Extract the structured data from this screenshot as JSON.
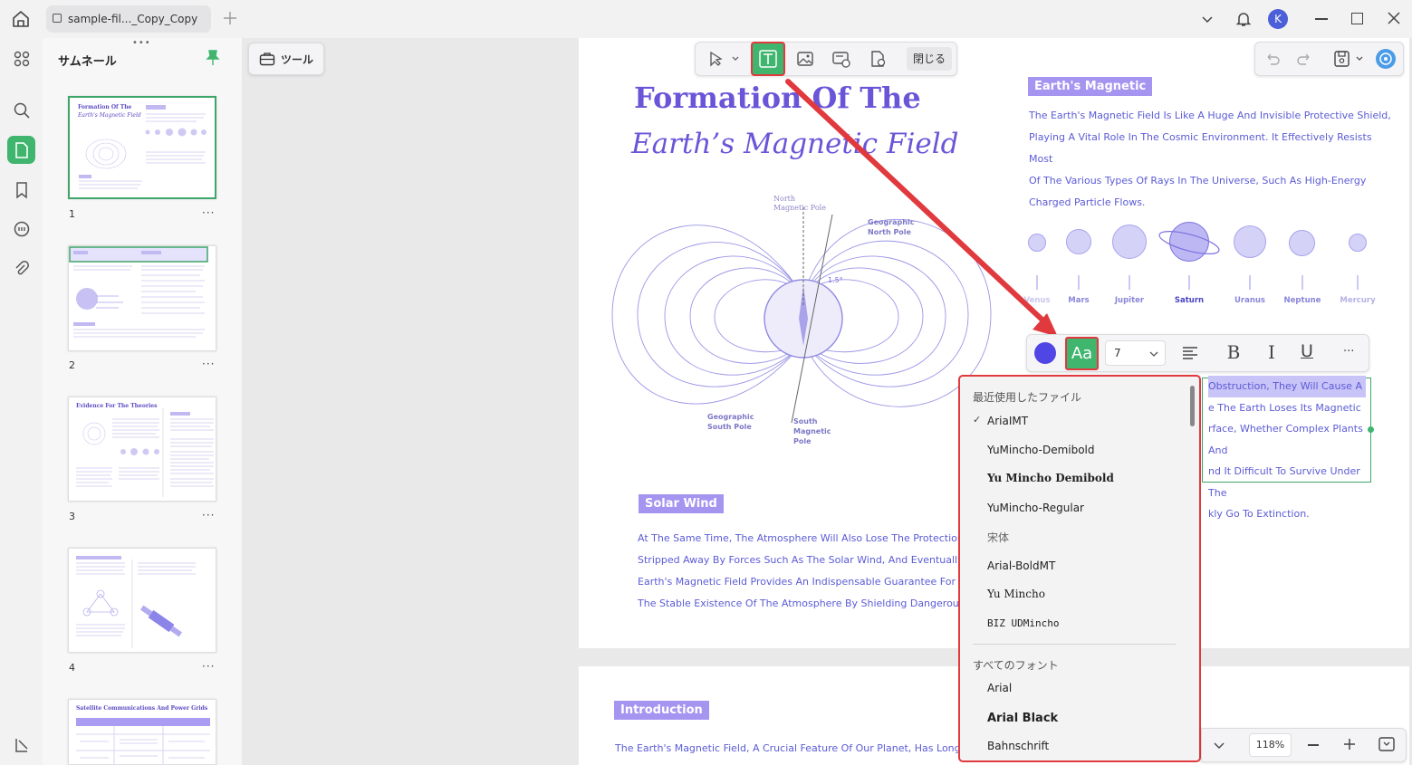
{
  "tabs": [
    {
      "label": "sample-fil..._Copy_Copy"
    }
  ],
  "window": {
    "avatar_letter": "K"
  },
  "sidebar": {
    "title": "サムネール",
    "pages": [
      {
        "num": "1"
      },
      {
        "num": "2"
      },
      {
        "num": "3"
      },
      {
        "num": "4"
      }
    ],
    "thumb_texts": {
      "p1_title": "Formation Of The",
      "p1_sub": "Earth's Magnetic Field",
      "p3_title": "Evidence For The Theories",
      "p5_title": "Satellite Communications And Power Grids"
    }
  },
  "tools_button": {
    "label": "ツール"
  },
  "edit_toolbar": {
    "close_label": "閉じる"
  },
  "document": {
    "title_line1": "Formation Of The",
    "title_line2": "Earth’s Magnetic Field",
    "diagram_labels": {
      "north_magnetic_pole": [
        "North",
        "Magnetic Pole"
      ],
      "geographic_north_pole": [
        "Geographic",
        "North Pole"
      ],
      "geographic_south_pole": [
        "Geographic",
        "South Pole"
      ],
      "south_magnetic_pole": [
        "South",
        "Magnetic",
        "Pole"
      ],
      "angle": "1.5°"
    },
    "earths_magnetic": {
      "tag": "Earth's Magnetic",
      "lines": [
        "The Earth's Magnetic Field Is Like A Huge And Invisible Protective Shield,",
        "Playing A Vital Role In The Cosmic Environment. It Effectively Resists Most",
        "Of The Various Types Of Rays In The Universe, Such As High-Energy",
        "Charged Particle Flows."
      ]
    },
    "planets": [
      "Venus",
      "Mars",
      "Jupiter",
      "Saturn",
      "Uranus",
      "Neptune",
      "Mercury"
    ],
    "selected_text_lines": [
      "Obstruction, They Will Cause A",
      "e The Earth Loses Its Magnetic",
      "rface, Whether Complex Plants And",
      "nd It Difficult To Survive Under The",
      "kly Go To Extinction."
    ],
    "solar_wind": {
      "tag": "Solar Wind",
      "lines": [
        "At The Same Time, The Atmosphere Will Also Lose The Protection Of T",
        "Stripped Away By Forces Such As The Solar Wind, And Eventually Disa",
        "Earth's Magnetic Field Provides An Indispensable Guarantee For The R",
        "The Stable Existence Of The Atmosphere By Shielding Dangerous Subs"
      ]
    },
    "introduction": {
      "tag": "Introduction",
      "line": "The Earth's Magnetic Field, A Crucial Feature Of Our Planet, Has Long"
    }
  },
  "text_toolbar": {
    "color": "#4f46e5",
    "font_icon": "Aa",
    "font_size": "7",
    "more": "···"
  },
  "font_dropdown": {
    "recent_header": "最近使用したファイル",
    "recent": [
      "AriaIMT",
      "YuMincho-Demibold",
      "Yu Mincho Demibold",
      "YuMincho-Regular",
      "宋体",
      "Arial-BoldMT",
      "Yu Mincho",
      "BIZ UDMincho"
    ],
    "checked": "AriaIMT",
    "all_header": "すべてのフォント",
    "all": [
      "Arial",
      "Arial Black",
      "Bahnschrift"
    ]
  },
  "zoom": {
    "value": "118%"
  },
  "colors": {
    "accent": "#3fb56e",
    "highlight": "#e0393e",
    "doc_purple": "#6a55d8"
  }
}
